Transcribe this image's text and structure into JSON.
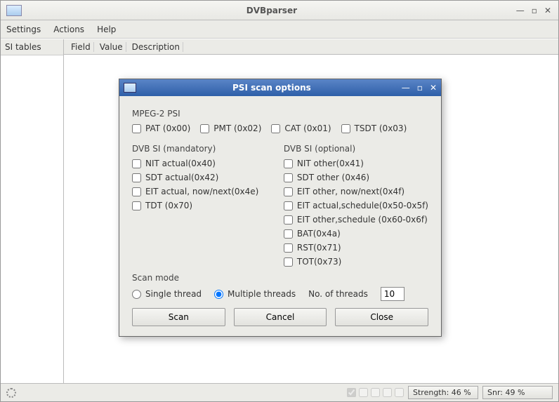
{
  "window": {
    "title": "DVBparser"
  },
  "menu": {
    "settings": "Settings",
    "actions": "Actions",
    "help": "Help"
  },
  "sidebar": {
    "header": "SI tables"
  },
  "columns": {
    "field": "Field",
    "value": "Value",
    "description": "Description"
  },
  "dialog": {
    "title": "PSI scan options",
    "mpeg2psi": {
      "label": "MPEG-2 PSI",
      "items": [
        "PAT (0x00)",
        "PMT (0x02)",
        "CAT (0x01)",
        "TSDT (0x03)"
      ]
    },
    "dvb_mandatory": {
      "label": "DVB SI (mandatory)",
      "items": [
        "NIT actual(0x40)",
        "SDT actual(0x42)",
        "EIT actual, now/next(0x4e)",
        "TDT (0x70)"
      ]
    },
    "dvb_optional": {
      "label": "DVB SI (optional)",
      "items": [
        "NIT other(0x41)",
        "SDT other (0x46)",
        "EIT other, now/next(0x4f)",
        "EIT actual,schedule(0x50-0x5f)",
        "EIT other,schedule (0x60-0x6f)",
        "BAT(0x4a)",
        "RST(0x71)",
        "TOT(0x73)"
      ]
    },
    "scan_mode": {
      "label": "Scan mode",
      "single": "Single thread",
      "multiple": "Multiple threads",
      "threads_label": "No. of threads",
      "threads_value": "10"
    },
    "buttons": {
      "scan": "Scan",
      "cancel": "Cancel",
      "close": "Close"
    }
  },
  "status": {
    "strength": "Strength: 46 %",
    "snr": "Snr: 49 %"
  }
}
